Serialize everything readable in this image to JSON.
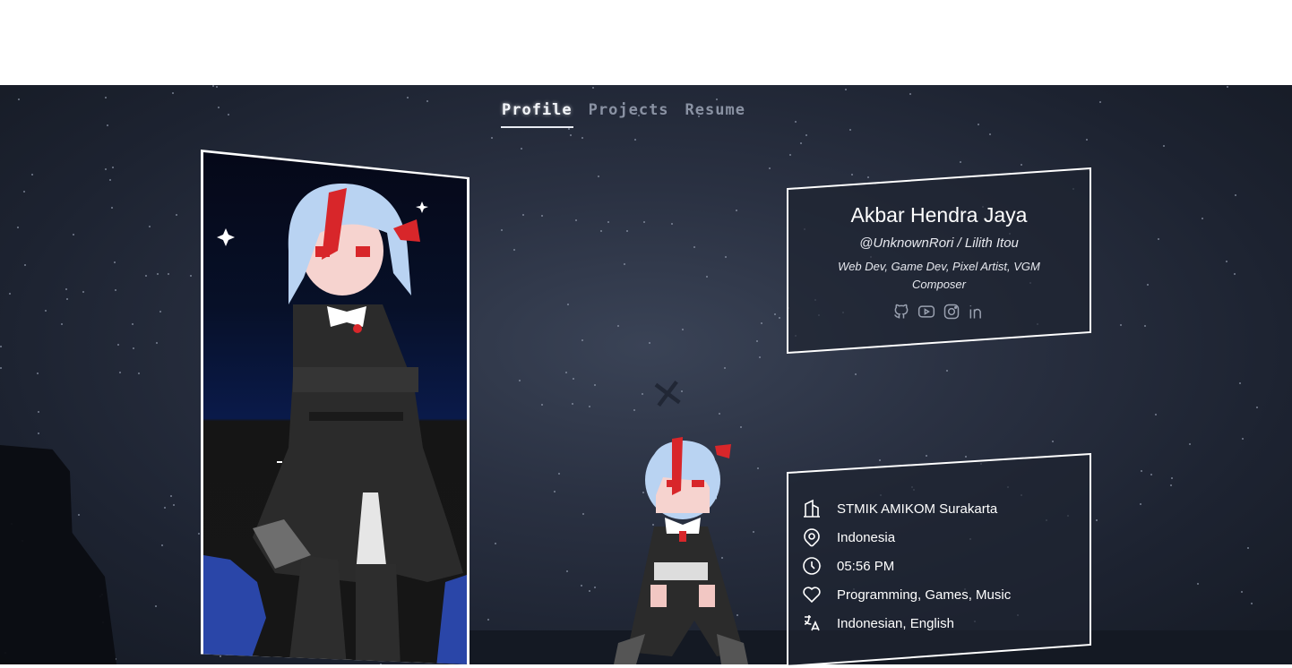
{
  "nav": {
    "tabs": [
      {
        "label": "Profile",
        "active": true
      },
      {
        "label": "Projects",
        "active": false
      },
      {
        "label": "Resume",
        "active": false
      }
    ]
  },
  "profile": {
    "name": "Akbar Hendra Jaya",
    "handle": "@UnknownRori / Lilith Itou",
    "roles": "Web Dev, Game Dev, Pixel Artist, VGM Composer",
    "socials": [
      "github-icon",
      "youtube-icon",
      "instagram-icon",
      "linkedin-icon"
    ]
  },
  "info": {
    "school": "STMIK AMIKOM Surakarta",
    "location": "Indonesia",
    "time": "05:56 PM",
    "interests": "Programming, Games, Music",
    "languages": "Indonesian, English"
  },
  "colors": {
    "background": "#242a38",
    "accent": "#ffffff",
    "hair": "#b9d3f2",
    "hair_streak": "#d8262a",
    "outfit": "#2a2a2a"
  }
}
